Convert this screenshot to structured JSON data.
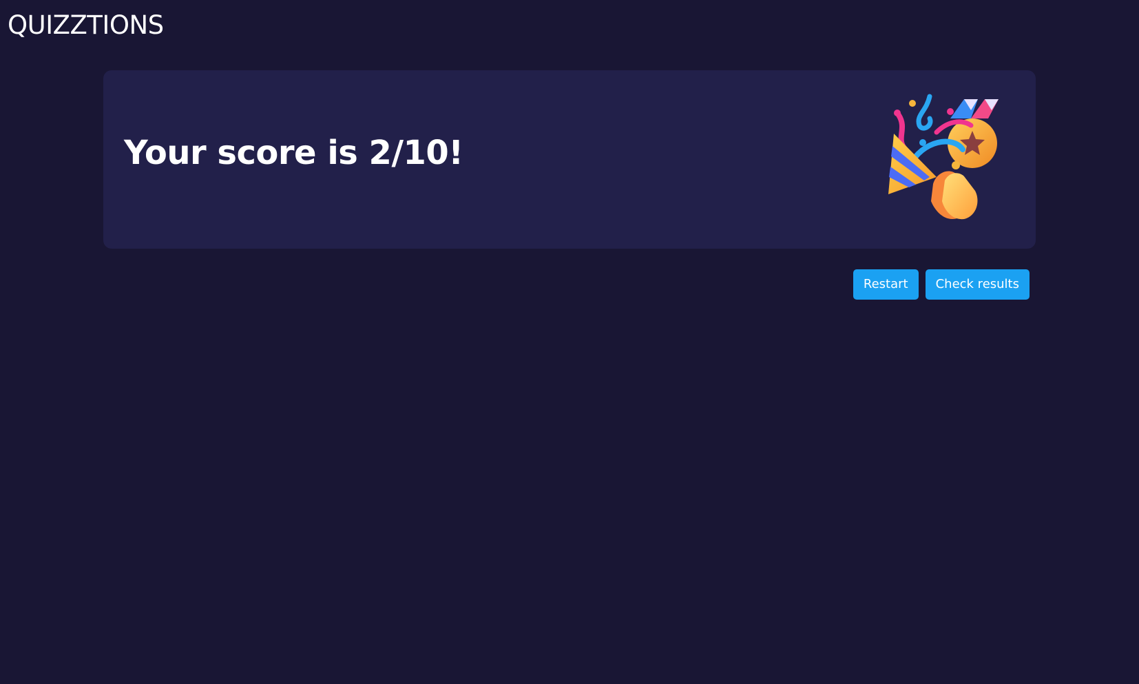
{
  "brand": {
    "name": "QUIZZTIONS"
  },
  "result": {
    "title": "Your score is 2/10!",
    "score": 2,
    "total": 10,
    "illustration": "party-popper-clapping-medal-icon"
  },
  "actions": {
    "restart_label": "Restart",
    "check_results_label": "Check results"
  },
  "colors": {
    "background": "#191634",
    "card": "#22204a",
    "accent": "#1ba1f2",
    "text": "#ffffff"
  }
}
